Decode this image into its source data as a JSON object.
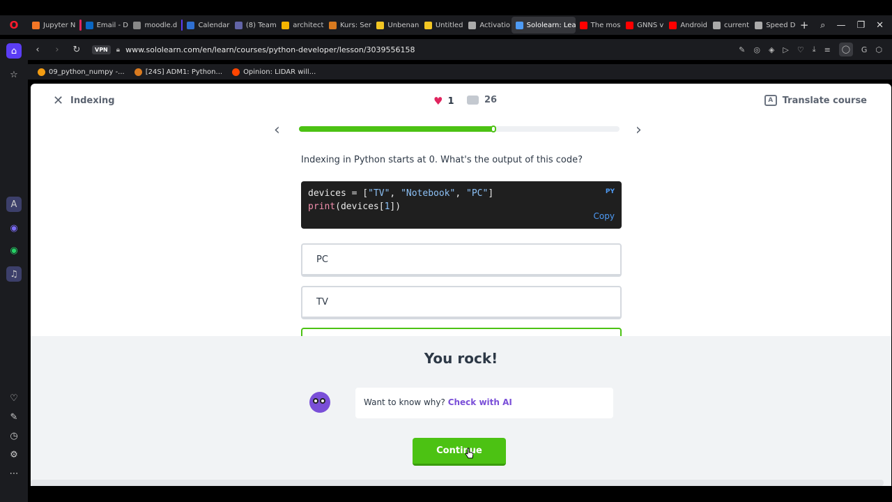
{
  "browser": {
    "tabs": [
      {
        "label": "Jupyter N",
        "color": "#f37626"
      },
      {
        "label": "Email - D",
        "color": "#0a66c2"
      },
      {
        "label": "moodle.d",
        "color": "#888888"
      },
      {
        "label": "Calendar",
        "color": "#2f6fd1"
      },
      {
        "label": "(8) Team",
        "color": "#6264a7"
      },
      {
        "label": "architect",
        "color": "#f4b400"
      },
      {
        "label": "Kurs: Ser",
        "color": "#d97a1f"
      },
      {
        "label": "Unbenan",
        "color": "#f3c623"
      },
      {
        "label": "Untitled",
        "color": "#f3c623"
      },
      {
        "label": "Activatio",
        "color": "#aaaaaa"
      },
      {
        "label": "Sololearn: Learn",
        "color": "#4e9bf5",
        "active": true
      },
      {
        "label": "The mos",
        "color": "#ff0000"
      },
      {
        "label": "GNNS v",
        "color": "#ff0000"
      },
      {
        "label": "Android",
        "color": "#ff0000"
      },
      {
        "label": "current",
        "color": "#aaaaaa"
      },
      {
        "label": "Speed D",
        "color": "#aaaaaa"
      }
    ],
    "url": "www.sololearn.com/en/learn/courses/python-developer/lesson/3039556158",
    "vpn_label": "VPN",
    "bookmarks": [
      {
        "label": "09_python_numpy -...",
        "color": "#f39c12"
      },
      {
        "label": "[24S] ADM1: Python...",
        "color": "#d97a1f"
      },
      {
        "label": "Opinion: LIDAR will...",
        "color": "#ff4500"
      }
    ]
  },
  "lesson": {
    "title": "Indexing",
    "hearts": "1",
    "comments": "26",
    "translate_label": "Translate course",
    "progress": 0.61,
    "question": "Indexing in Python starts at 0. What's the output of this code?",
    "code": {
      "lang": "PY",
      "copy_label": "Copy",
      "line1_a": "devices = [",
      "line1_s1": "\"TV\"",
      "line1_sep1": ", ",
      "line1_s2": "\"Notebook\"",
      "line1_sep2": ", ",
      "line1_s3": "\"PC\"",
      "line1_end": "]",
      "line2_fn": "print",
      "line2_a": "(devices[",
      "line2_num": "1",
      "line2_end": "])"
    },
    "options": [
      "PC",
      "TV"
    ]
  },
  "result": {
    "title": "You rock!",
    "ai_prompt": "Want to know why?",
    "ai_link": "Check with AI",
    "continue_label": "Continue"
  },
  "colors": {
    "accent_green": "#4cc213",
    "heart": "#e0245e",
    "ai_purple": "#7a4fd8"
  }
}
